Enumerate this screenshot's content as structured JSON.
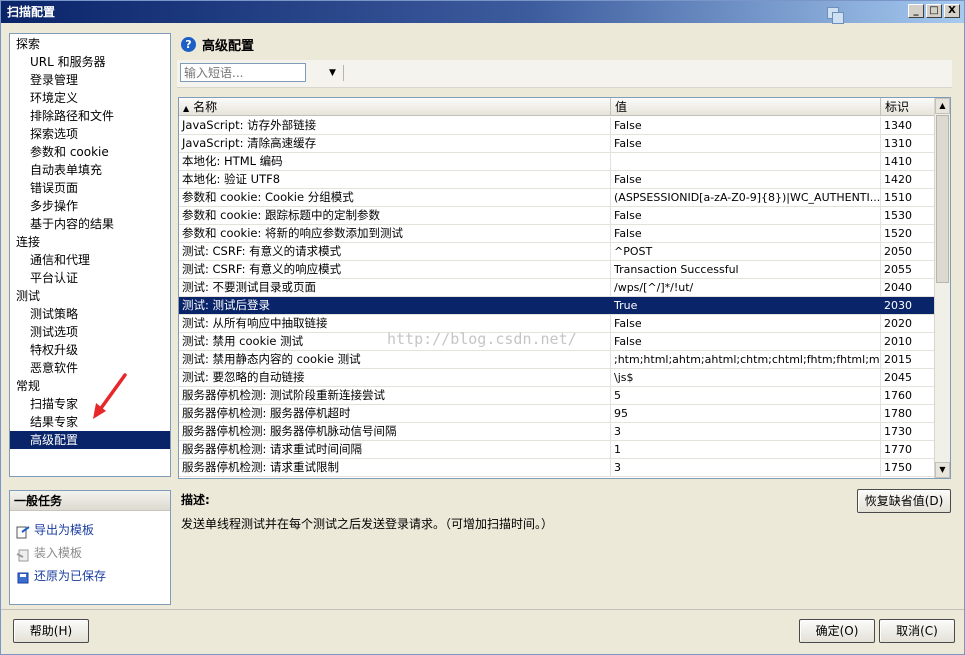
{
  "window": {
    "title": "扫描配置",
    "buttons": {
      "minimize": "_",
      "maximize": "□",
      "close": "X"
    }
  },
  "tree": {
    "items": [
      {
        "label": "探索",
        "level": 0
      },
      {
        "label": "URL 和服务器",
        "level": 1
      },
      {
        "label": "登录管理",
        "level": 1
      },
      {
        "label": "环境定义",
        "level": 1
      },
      {
        "label": "排除路径和文件",
        "level": 1
      },
      {
        "label": "探索选项",
        "level": 1
      },
      {
        "label": "参数和 cookie",
        "level": 1
      },
      {
        "label": "自动表单填充",
        "level": 1
      },
      {
        "label": "错误页面",
        "level": 1
      },
      {
        "label": "多步操作",
        "level": 1
      },
      {
        "label": "基于内容的结果",
        "level": 1
      },
      {
        "label": "连接",
        "level": 0
      },
      {
        "label": "通信和代理",
        "level": 1
      },
      {
        "label": "平台认证",
        "level": 1
      },
      {
        "label": "测试",
        "level": 0
      },
      {
        "label": "测试策略",
        "level": 1
      },
      {
        "label": "测试选项",
        "level": 1
      },
      {
        "label": "特权升级",
        "level": 1
      },
      {
        "label": "恶意软件",
        "level": 1
      },
      {
        "label": "常规",
        "level": 0
      },
      {
        "label": "扫描专家",
        "level": 1
      },
      {
        "label": "结果专家",
        "level": 1
      },
      {
        "label": "高级配置",
        "level": 1,
        "selected": true
      }
    ]
  },
  "tasks": {
    "header": "一般任务",
    "items": [
      {
        "label": "导出为模板",
        "icon": "export-template-icon",
        "enabled": true
      },
      {
        "label": "装入模板",
        "icon": "load-template-icon",
        "enabled": false
      },
      {
        "label": "还原为已保存",
        "icon": "restore-saved-icon",
        "enabled": true
      }
    ]
  },
  "main": {
    "title": "高级配置",
    "search": {
      "placeholder": "输入短语..."
    },
    "columns": {
      "name": "名称",
      "value": "值",
      "id": "标识"
    },
    "rows": [
      {
        "name": "JavaScript: 访存外部链接",
        "value": "False",
        "id": "1340"
      },
      {
        "name": "JavaScript: 清除高速缓存",
        "value": "False",
        "id": "1310"
      },
      {
        "name": "本地化: HTML 编码",
        "value": "",
        "id": "1410"
      },
      {
        "name": "本地化: 验证 UTF8",
        "value": "False",
        "id": "1420"
      },
      {
        "name": "参数和 cookie: Cookie 分组模式",
        "value": "(ASPSESSIONID[a-zA-Z0-9]{8})|WC_AUTHENTI...",
        "id": "1510"
      },
      {
        "name": "参数和 cookie: 跟踪标题中的定制参数",
        "value": "False",
        "id": "1530"
      },
      {
        "name": "参数和 cookie: 将新的响应参数添加到测试",
        "value": "False",
        "id": "1520"
      },
      {
        "name": "测试: CSRF: 有意义的请求模式",
        "value": "^POST",
        "id": "2050"
      },
      {
        "name": "测试: CSRF: 有意义的响应模式",
        "value": "Transaction Successful",
        "id": "2055"
      },
      {
        "name": "测试: 不要测试目录或页面",
        "value": "/wps/[^/]*/!ut/",
        "id": "2040"
      },
      {
        "name": "测试: 测试后登录",
        "value": "True",
        "id": "2030",
        "selected": true
      },
      {
        "name": "测试: 从所有响应中抽取链接",
        "value": "False",
        "id": "2020"
      },
      {
        "name": "测试: 禁用 cookie 测试",
        "value": "False",
        "id": "2010"
      },
      {
        "name": "测试: 禁用静态内容的 cookie 测试",
        "value": ";htm;html;ahtm;ahtml;chtm;chtml;fhtm;fhtml;m...",
        "id": "2015"
      },
      {
        "name": "测试: 要忽略的自动链接",
        "value": "\\js$",
        "id": "2045"
      },
      {
        "name": "服务器停机检测: 测试阶段重新连接尝试",
        "value": "5",
        "id": "1760"
      },
      {
        "name": "服务器停机检测: 服务器停机超时",
        "value": "95",
        "id": "1780"
      },
      {
        "name": "服务器停机检测: 服务器停机脉动信号间隔",
        "value": "3",
        "id": "1730"
      },
      {
        "name": "服务器停机检测: 请求重试时间间隔",
        "value": "1",
        "id": "1770"
      },
      {
        "name": "服务器停机检测: 请求重试限制",
        "value": "3",
        "id": "1750"
      }
    ],
    "description_label": "描述:",
    "description": "发送单线程测试并在每个测试之后发送登录请求。（可增加扫描时间。）",
    "restore_defaults_label": "恢复缺省值(D)"
  },
  "watermark": "http://blog.csdn.net/",
  "footer": {
    "help_label": "帮助(H)",
    "ok_label": "确定(O)",
    "cancel_label": "取消(C)"
  },
  "colors": {
    "selection": "#0a246a",
    "annotation_arrow": "#e8272a"
  }
}
